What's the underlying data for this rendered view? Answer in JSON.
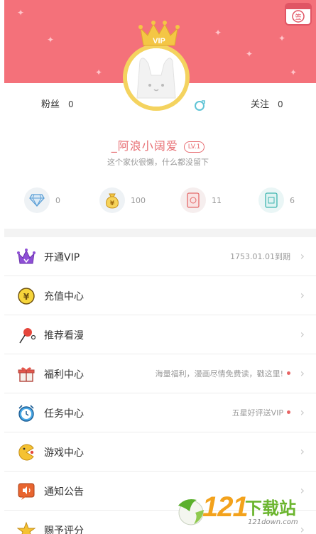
{
  "header": {
    "sign_icon_label": "签",
    "vip_label": "VIP",
    "colors": {
      "banner": "#f4717a",
      "crown": "#f4d35f",
      "accent": "#e76d72"
    }
  },
  "stats": {
    "fans_label": "粉丝",
    "fans_count": "0",
    "follow_label": "关注",
    "follow_count": "0"
  },
  "profile": {
    "username": "_阿浪小阔爱",
    "level": "LV.1",
    "bio": "这个家伙很懒，什么都没留下"
  },
  "wallet": [
    {
      "icon": "diamond-icon",
      "value": "0"
    },
    {
      "icon": "coin-bag-icon",
      "value": "100"
    },
    {
      "icon": "ticket-icon",
      "value": "11"
    },
    {
      "icon": "monthly-ticket-icon",
      "value": "6"
    }
  ],
  "menu": [
    {
      "icon": "crown-icon",
      "label": "开通VIP",
      "right": "1753.01.01到期",
      "dot": false
    },
    {
      "icon": "coin-icon",
      "label": "充值中心",
      "right": "",
      "dot": false
    },
    {
      "icon": "lollipop-icon",
      "label": "推荐看漫",
      "right": "",
      "dot": false
    },
    {
      "icon": "gift-icon",
      "label": "福利中心",
      "right": "海量福利，漫画尽情免费读，戳这里!",
      "dot": true
    },
    {
      "icon": "alarm-clock-icon",
      "label": "任务中心",
      "right": "五星好评送VIP",
      "dot": true
    },
    {
      "icon": "game-icon",
      "label": "游戏中心",
      "right": "",
      "dot": false
    },
    {
      "icon": "speaker-icon",
      "label": "通知公告",
      "right": "",
      "dot": false
    },
    {
      "icon": "star-icon",
      "label": "赐予评分",
      "right": "",
      "dot": false
    }
  ],
  "watermark": {
    "number": "121",
    "text": "下载站",
    "site": "121down.com"
  }
}
